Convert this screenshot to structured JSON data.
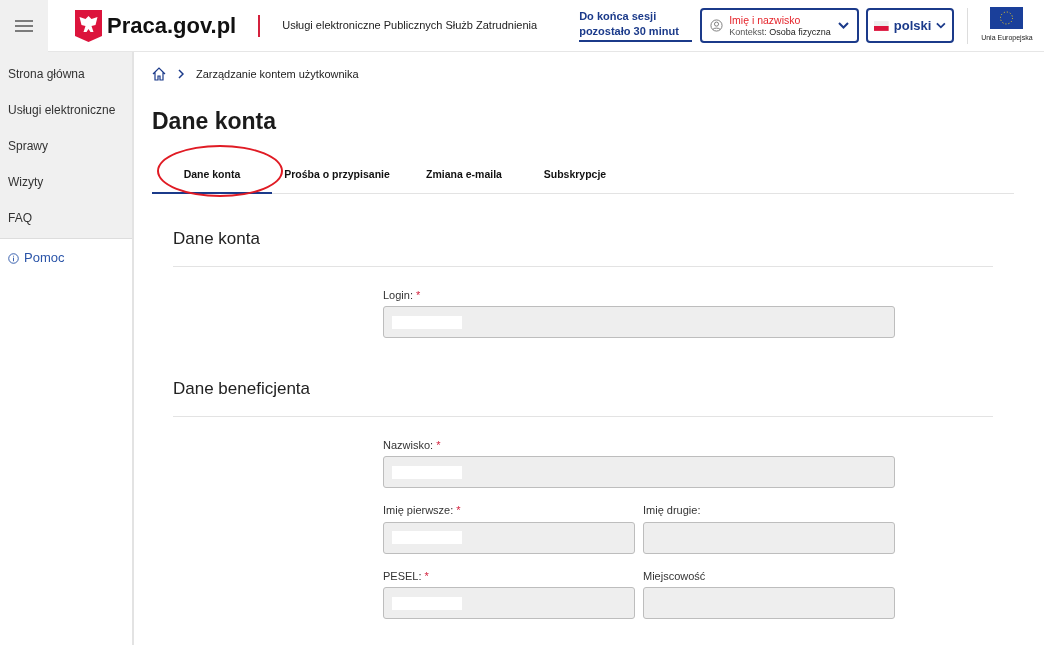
{
  "header": {
    "logo": "Praca.gov.pl",
    "subtitle": "Usługi elektroniczne Publicznych Służb Zatrudnienia",
    "session": "Do końca sesji pozostało 30 minut",
    "user": {
      "name": "Imię i nazwisko",
      "context_label": "Kontekst:",
      "context": "Osoba fizyczna"
    },
    "language": "polski",
    "eu_label": "Unia Europejska"
  },
  "sidebar": {
    "items": [
      {
        "label": "Strona główna"
      },
      {
        "label": "Usługi elektroniczne"
      },
      {
        "label": "Sprawy"
      },
      {
        "label": "Wizyty"
      },
      {
        "label": "FAQ"
      }
    ],
    "help": "Pomoc"
  },
  "breadcrumb": [
    "Zarządzanie kontem użytkownika"
  ],
  "title": "Dane konta",
  "tabs": [
    {
      "label": "Dane konta",
      "selected": true,
      "circled": true
    },
    {
      "label": "Prośba o przypisanie",
      "selected": false,
      "circled": false
    },
    {
      "label": "Zmiana e-maila",
      "selected": false,
      "circled": false
    },
    {
      "label": "Subskrypcje",
      "selected": false,
      "circled": false
    }
  ],
  "sections": [
    {
      "title": "Dane konta",
      "rows": [
        [
          {
            "label": "Login:",
            "marker": "*",
            "redacted": true
          }
        ]
      ]
    },
    {
      "title": "Dane beneficjenta",
      "rows": [
        [
          {
            "label": "Nazwisko:",
            "marker": "*",
            "redacted": true
          }
        ],
        [
          {
            "label": "Imię pierwsze:",
            "marker": "*",
            "redacted": true
          },
          {
            "label": "Imię drugie:",
            "redacted": false
          }
        ],
        [
          {
            "label": "PESEL:",
            "marker": "*",
            "redacted": true
          },
          {
            "label": "Miejscowość",
            "redacted": false
          }
        ]
      ]
    }
  ]
}
